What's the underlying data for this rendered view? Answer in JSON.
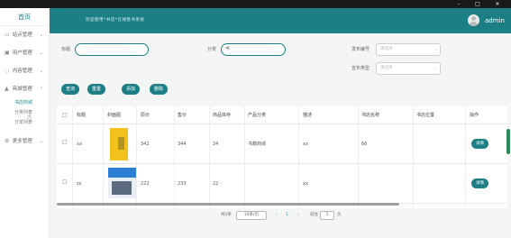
{
  "window": {
    "minimize": "–",
    "maximize": "□",
    "close": "✕"
  },
  "sidebar": {
    "home": "首页",
    "items": [
      {
        "label": "站点管理",
        "icon": "monitor-icon",
        "glyph": "▭"
      },
      {
        "label": "用户管理",
        "icon": "user-icon",
        "glyph": "▣"
      },
      {
        "label": "内容管理",
        "icon": "chat-icon",
        "glyph": "◌"
      },
      {
        "label": "商城管理",
        "icon": "shop-icon",
        "glyph": "▲",
        "expanded": true
      }
    ],
    "sub_items": [
      {
        "label": "书店商城",
        "active": true
      },
      {
        "label": "分类列表",
        "active": false
      },
      {
        "label": "订单列表",
        "active": false
      }
    ],
    "more": {
      "label": "更多管理",
      "icon": "gear-icon",
      "glyph": "⚙"
    }
  },
  "header": {
    "title": "欢迎使用*书店*在线售书系统",
    "user": "admin"
  },
  "filters": {
    "title_label": "标题",
    "title_value": "",
    "category_label": "分类",
    "category_value": "书",
    "product_no_label": "发布编号",
    "product_no_placeholder": "请选择",
    "type_label": "宣布类型",
    "type_placeholder": "请选择"
  },
  "buttons": {
    "query": "查询",
    "reset": "重置",
    "add": "添加",
    "delete": "删除"
  },
  "table": {
    "headers": [
      "标题",
      "封面图",
      "原价",
      "售价",
      "商品库存",
      "产品分类",
      "描述",
      "书店名称",
      "书店位置",
      "操作"
    ],
    "rows": [
      {
        "title": "xx",
        "image": "book",
        "original_price": "342",
        "price": "344",
        "stock": "24",
        "category": "书籍商城",
        "description": "xx",
        "store_name": "66",
        "store_location": "",
        "action": "详情"
      },
      {
        "title": "zz",
        "image": "device",
        "original_price": "222",
        "price": "233",
        "stock": "22",
        "category": "",
        "description": "xx",
        "store_name": "",
        "store_location": "",
        "action": "详情"
      }
    ]
  },
  "pagination": {
    "total": "共2条",
    "page_size": "10条/页",
    "prev": "<",
    "current": "1",
    "next": ">",
    "goto_label": "前往",
    "goto_value": "1",
    "goto_suffix": "页"
  },
  "colors": {
    "accent": "#1d7f86",
    "topbar": "#1d7f86"
  }
}
